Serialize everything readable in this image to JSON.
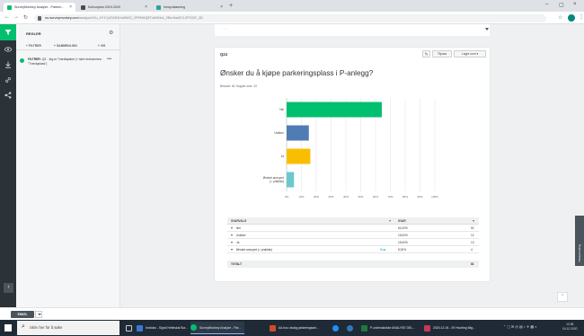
{
  "browser": {
    "tabs": [
      {
        "title": "SurveyMonkey Analyze - Parkeri...",
        "favicon": "#00bf6f",
        "active": true
      },
      {
        "title": "Kullvurplan 2019-2020",
        "favicon": "#4a4a4a",
        "active": false
      },
      {
        "title": "Innsynsløsning",
        "favicon": "#26a69a",
        "active": false
      }
    ],
    "url_host": "no.surveymonkey.com",
    "url_path": "/analyze/VIu_0Y17pGV3NHm5WO_2FRNHQ8TvN9Mx4_2BcrNsit2CL2POCE_3D"
  },
  "rail": {
    "icons": [
      "filter-icon",
      "eye-icon",
      "download-icon",
      "link-icon",
      "share-icon"
    ]
  },
  "rules_panel": {
    "title": "REGLER",
    "actions": [
      "+ FILTRER",
      "+ SAMMENLIGN",
      "+ VIS"
    ],
    "filter": {
      "label": "FILTRER:",
      "text": "Q3 - Jeg er Tverdlapsker (+ skriv innkommes: \"Tverdoplass\")"
    }
  },
  "question": {
    "number": "Q24",
    "customize_icon": "pencil-icon",
    "buttons": [
      "Tilpass",
      "Lagre som ▾"
    ],
    "title": "Ønsker du å kjøpe parkeringsplass i P-anlegg?",
    "stats": "Besvart: 81    Hoppet over: 42"
  },
  "chart_data": {
    "type": "bar",
    "orientation": "horizontal",
    "categories": [
      "Nei",
      "Usikker",
      "Ja",
      "Ønsket anonymt (= praktisk)"
    ],
    "values": [
      64.2,
      15,
      16,
      5
    ],
    "colors": [
      "#00bf6f",
      "#507cb6",
      "#f9be00",
      "#6bc8cd"
    ],
    "xlim": [
      0,
      100
    ],
    "xticks": [
      "0%",
      "10%",
      "20%",
      "30%",
      "40%",
      "50%",
      "60%",
      "70%",
      "80%",
      "90%",
      "100%"
    ],
    "grid": true
  },
  "table": {
    "headers": [
      "SVARVALG",
      "SVAR"
    ],
    "rows": [
      {
        "label": "Nei",
        "pct": "64,20%",
        "count": "52",
        "link": ""
      },
      {
        "label": "Usikker",
        "pct": "15,00%",
        "count": "12",
        "link": ""
      },
      {
        "label": "Ja",
        "pct": "15,00%",
        "count": "13",
        "link": ""
      },
      {
        "label": "Ønsket anonymt (= praktisk)",
        "pct": "5,00%",
        "count": "4",
        "link": "Svar"
      }
    ],
    "total_label": "TOTALT",
    "total_value": "81"
  },
  "feedback": "Tilbakemelding",
  "bottom": {
    "pill": "ENKEL"
  },
  "taskbar": {
    "search_placeholder": "Skriv her for å søke",
    "items": [
      {
        "label": "Innboks - Sigrid Helleskal Bur...",
        "color": "#3b78d0"
      },
      {
        "label": "SurveyMonkey Analyze - Par...",
        "color": "#00bf6f"
      },
      {
        "label": "Ad-hoc utvalg parkeringsanl...",
        "color": "#d04a2a"
      },
      {
        "label": "P-ordensklokke ANALYSE DEL...",
        "color": "#1e7a3a"
      },
      {
        "label": "2020-12-04 - 09 Hvorting Mig...",
        "color": "#c2395a"
      }
    ],
    "clock_time": "13:35",
    "clock_date": "04.12.2020"
  }
}
